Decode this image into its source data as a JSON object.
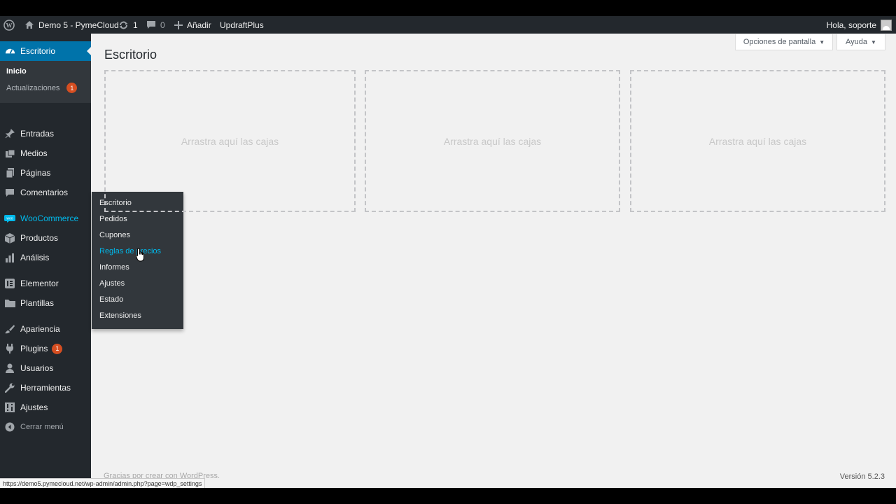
{
  "adminbar": {
    "site_name": "Demo 5 - PymeCloud",
    "updates_count": "1",
    "comments_count": "0",
    "add_new": "Añadir",
    "plugin_link": "UpdraftPlus",
    "greeting": "Hola, soporte",
    "icons": [
      "wordpress-logo-icon",
      "home-icon",
      "refresh-icon",
      "comment-icon",
      "plus-icon",
      "avatar"
    ]
  },
  "sidebar": {
    "dashboard": "Escritorio",
    "dashboard_sub": {
      "home": "Inicio",
      "updates": "Actualizaciones",
      "updates_badge": "1"
    },
    "items": [
      {
        "label": "Entradas",
        "icon": "pin-icon"
      },
      {
        "label": "Medios",
        "icon": "media-icon"
      },
      {
        "label": "Páginas",
        "icon": "pages-icon"
      },
      {
        "label": "Comentarios",
        "icon": "comment-icon"
      },
      {
        "label": "WooCommerce",
        "icon": "woo-icon"
      },
      {
        "label": "Productos",
        "icon": "box-icon"
      },
      {
        "label": "Análisis",
        "icon": "chart-icon"
      },
      {
        "label": "Elementor",
        "icon": "elementor-icon"
      },
      {
        "label": "Plantillas",
        "icon": "folder-icon"
      },
      {
        "label": "Apariencia",
        "icon": "brush-icon"
      },
      {
        "label": "Plugins",
        "icon": "plug-icon",
        "badge": "1"
      },
      {
        "label": "Usuarios",
        "icon": "user-icon"
      },
      {
        "label": "Herramientas",
        "icon": "wrench-icon"
      },
      {
        "label": "Ajustes",
        "icon": "settings-icon"
      },
      {
        "label": "Cerrar menú",
        "icon": "collapse-icon"
      }
    ]
  },
  "flyout": {
    "items": [
      "Escritorio",
      "Pedidos",
      "Cupones",
      "Reglas de precios",
      "Informes",
      "Ajustes",
      "Estado",
      "Extensiones"
    ],
    "active_index": 3
  },
  "main": {
    "title": "Escritorio",
    "screen_options": "Opciones de pantalla",
    "help": "Ayuda",
    "dropzones": [
      "Arrastra aquí las cajas",
      "Arrastra aquí las cajas",
      "Arrastra aquí las cajas"
    ],
    "footer_thanks": "Gracias por crear con WordPress.",
    "version": "Versión 5.2.3"
  },
  "status_url": "https://demo5.pymecloud.net/wp-admin/admin.php?page=wdp_settings",
  "colors": {
    "admin_dark": "#23282d",
    "admin_sub": "#32373c",
    "accent_blue": "#0073aa",
    "highlight": "#00b9eb",
    "badge": "#d54e21",
    "page_bg": "#f1f1f1"
  }
}
